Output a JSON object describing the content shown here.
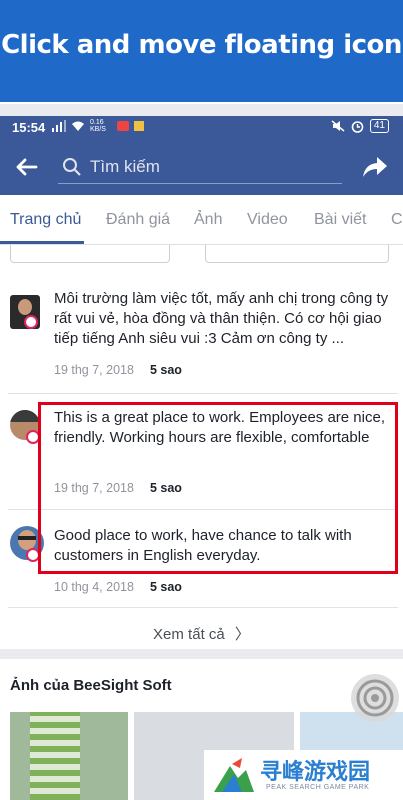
{
  "banner": {
    "title": "Click and move floating icon"
  },
  "statusbar": {
    "time": "15:54",
    "speed": "0.16 KB/S",
    "battery": "41"
  },
  "appbar": {
    "search_placeholder": "Tìm kiếm"
  },
  "tabs": [
    {
      "label": "Trang chủ",
      "active": true
    },
    {
      "label": "Đánh giá"
    },
    {
      "label": "Ảnh"
    },
    {
      "label": "Video"
    },
    {
      "label": "Bài viết"
    },
    {
      "label": "C"
    }
  ],
  "reviews": [
    {
      "text": "Môi trường làm việc tốt, mấy anh chị trong công ty rất vui vẻ, hòa đồng và thân thiện. Có cơ hội giao tiếp tiếng Anh siêu vui :3 Cảm ơn công ty ...",
      "date": "19 thg 7, 2018",
      "rating": "5 sao"
    },
    {
      "text": "This is a great place to work. Employees are nice, friendly. Working hours are flexible, comfortable",
      "date": "19 thg 7, 2018",
      "rating": "5 sao"
    },
    {
      "text": "Good place to work, have chance to talk with customers in English everyday.",
      "date": "10 thg 4, 2018",
      "rating": "5 sao"
    }
  ],
  "see_all": {
    "label": "Xem tất cả"
  },
  "photos": {
    "title": "Ảnh của BeeSight Soft"
  },
  "watermark": {
    "text": "寻峰游戏园",
    "sub": "PEAK SEARCH GAME PARK"
  },
  "colors": {
    "brand": "#3b5998",
    "banner": "#1f6ac9",
    "highlight": "#e0001b"
  }
}
